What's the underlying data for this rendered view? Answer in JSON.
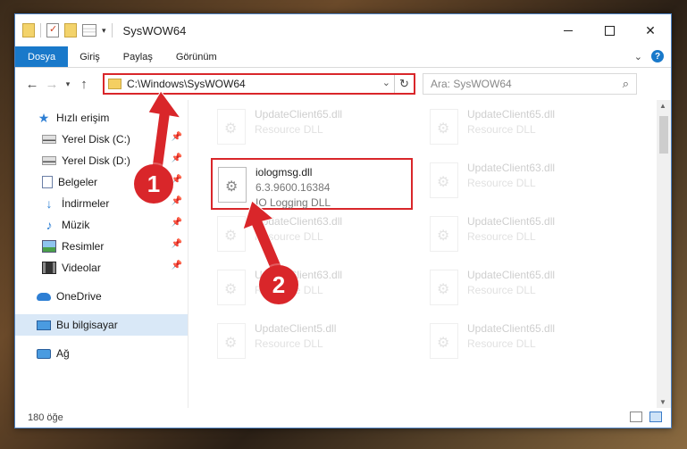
{
  "window": {
    "title": "SysWOW64",
    "controls": {
      "minimize": "—",
      "maximize": "☐",
      "close": "✕"
    }
  },
  "ribbon": {
    "tabs": [
      {
        "label": "Dosya",
        "active": true
      },
      {
        "label": "Giriş",
        "active": false
      },
      {
        "label": "Paylaş",
        "active": false
      },
      {
        "label": "Görünüm",
        "active": false
      }
    ],
    "expand_icon": "chevron-down-icon",
    "help_icon": "help-icon"
  },
  "address": {
    "path": "C:\\Windows\\SysWOW64",
    "search_placeholder": "Ara: SysWOW64"
  },
  "sidebar": {
    "items": [
      {
        "label": "Hızlı erişim",
        "icon": "star-icon",
        "pinned": false
      },
      {
        "label": "Yerel Disk (C:)",
        "icon": "disk-icon",
        "pinned": true
      },
      {
        "label": "Yerel Disk (D:)",
        "icon": "disk-icon",
        "pinned": true
      },
      {
        "label": "Belgeler",
        "icon": "documents-icon",
        "pinned": true
      },
      {
        "label": "İndirmeler",
        "icon": "download-icon",
        "pinned": true
      },
      {
        "label": "Müzik",
        "icon": "music-icon",
        "pinned": true
      },
      {
        "label": "Resimler",
        "icon": "pictures-icon",
        "pinned": true
      },
      {
        "label": "Videolar",
        "icon": "videos-icon",
        "pinned": true
      },
      {
        "label": "OneDrive",
        "icon": "onedrive-icon",
        "pinned": false
      },
      {
        "label": "Bu bilgisayar",
        "icon": "computer-icon",
        "pinned": false,
        "selected": true
      },
      {
        "label": "Ağ",
        "icon": "network-icon",
        "pinned": false
      }
    ]
  },
  "files": {
    "highlighted": {
      "name": "iologmsg.dll",
      "version": "6.3.9600.16384",
      "description": "IO Logging DLL"
    },
    "ghost": [
      {
        "name": "UpdateClient65.dll",
        "type": "Resource DLL"
      },
      {
        "name": "UpdateClient65.dll",
        "type": "Resource DLL"
      },
      {
        "name": "UpdateClient63.dll",
        "type": "Resource DLL"
      },
      {
        "name": "UpdateClient63.dll",
        "type": "Resource DLL"
      },
      {
        "name": "UpdateClient65.dll",
        "type": "Resource DLL"
      },
      {
        "name": "UpdateClient63.dll",
        "type": "Resource DLL"
      },
      {
        "name": "UpdateClient65.dll",
        "type": "Resource DLL"
      },
      {
        "name": "UpdateClient5.dll",
        "type": "Resource DLL"
      },
      {
        "name": "UpdateClient65.dll",
        "type": "Resource DLL"
      }
    ]
  },
  "status": {
    "item_count": "180 öğe"
  },
  "annotations": {
    "badge1": "1",
    "badge2": "2",
    "color": "#d9262a"
  }
}
